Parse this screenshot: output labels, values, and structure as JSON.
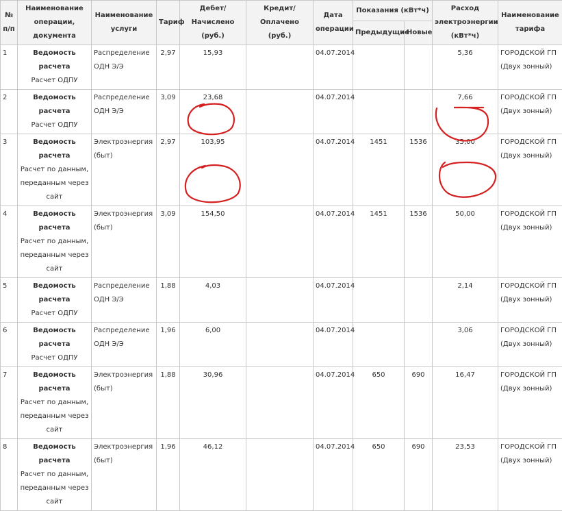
{
  "headers": {
    "num": "№ п/п",
    "operation": "Наименование операции, документа",
    "service": "Наименование услуги",
    "tariff": "Тариф",
    "debit": "Дебет/Начислено (руб.)",
    "credit": "Кредит/Оплачено (руб.)",
    "date": "Дата операции",
    "readings": "Показания (кВт*ч)",
    "readings_prev": "Предыдущие",
    "readings_new": "Новые",
    "consumption": "Расход электроэнергии (кВт*ч)",
    "tariff_name": "Наименование тарифа"
  },
  "rows": [
    {
      "num": "1",
      "doc": "Ведомость расчета",
      "doc_sub": [
        "Расчет ОДПУ"
      ],
      "service": [
        "Распределение",
        "ОДН Э/Э"
      ],
      "tariff": "2,97",
      "debit": "15,93",
      "credit": "",
      "date": "04.07.2014",
      "prev": "",
      "new": "",
      "consumption": "5,36",
      "tariff_name": [
        "ГОРОДСКОЙ ГП",
        "(Двух зонный)"
      ]
    },
    {
      "num": "2",
      "doc": "Ведомость расчета",
      "doc_sub": [
        "Расчет ОДПУ"
      ],
      "service": [
        "Распределение",
        "ОДН Э/Э"
      ],
      "tariff": "3,09",
      "debit": "23,68",
      "credit": "",
      "date": "04.07.2014",
      "prev": "",
      "new": "",
      "consumption": "7,66",
      "tariff_name": [
        "ГОРОДСКОЙ ГП",
        "(Двух зонный)"
      ]
    },
    {
      "num": "3",
      "doc": "Ведомость расчета",
      "doc_sub": [
        "Расчет по данным,",
        "переданным через",
        "сайт"
      ],
      "service": [
        "Электроэнергия",
        "(быт)"
      ],
      "tariff": "2,97",
      "debit": "103,95",
      "credit": "",
      "date": "04.07.2014",
      "prev": "1451",
      "new": "1536",
      "consumption": "35,00",
      "tariff_name": [
        "ГОРОДСКОЙ ГП",
        "(Двух зонный)"
      ]
    },
    {
      "num": "4",
      "doc": "Ведомость расчета",
      "doc_sub": [
        "Расчет по данным,",
        "переданным через",
        "сайт"
      ],
      "service": [
        "Электроэнергия",
        "(быт)"
      ],
      "tariff": "3,09",
      "debit": "154,50",
      "credit": "",
      "date": "04.07.2014",
      "prev": "1451",
      "new": "1536",
      "consumption": "50,00",
      "tariff_name": [
        "ГОРОДСКОЙ ГП",
        "(Двух зонный)"
      ]
    },
    {
      "num": "5",
      "doc": "Ведомость расчета",
      "doc_sub": [
        "Расчет ОДПУ"
      ],
      "service": [
        "Распределение",
        "ОДН Э/Э"
      ],
      "tariff": "1,88",
      "debit": "4,03",
      "credit": "",
      "date": "04.07.2014",
      "prev": "",
      "new": "",
      "consumption": "2,14",
      "tariff_name": [
        "ГОРОДСКОЙ ГП",
        "(Двух зонный)"
      ]
    },
    {
      "num": "6",
      "doc": "Ведомость расчета",
      "doc_sub": [
        "Расчет ОДПУ"
      ],
      "service": [
        "Распределение",
        "ОДН Э/Э"
      ],
      "tariff": "1,96",
      "debit": "6,00",
      "credit": "",
      "date": "04.07.2014",
      "prev": "",
      "new": "",
      "consumption": "3,06",
      "tariff_name": [
        "ГОРОДСКОЙ ГП",
        "(Двух зонный)"
      ]
    },
    {
      "num": "7",
      "doc": "Ведомость расчета",
      "doc_sub": [
        "Расчет по данным,",
        "переданным через",
        "сайт"
      ],
      "service": [
        "Электроэнергия",
        "(быт)"
      ],
      "tariff": "1,88",
      "debit": "30,96",
      "credit": "",
      "date": "04.07.2014",
      "prev": "650",
      "new": "690",
      "consumption": "16,47",
      "tariff_name": [
        "ГОРОДСКОЙ ГП",
        "(Двух зонный)"
      ]
    },
    {
      "num": "8",
      "doc": "Ведомость расчета",
      "doc_sub": [
        "Расчет по данным,",
        "переданным через",
        "сайт"
      ],
      "service": [
        "Электроэнергия",
        "(быт)"
      ],
      "tariff": "1,96",
      "debit": "46,12",
      "credit": "",
      "date": "04.07.2014",
      "prev": "650",
      "new": "690",
      "consumption": "23,53",
      "tariff_name": [
        "ГОРОДСКОЙ ГП",
        "(Двух зонный)"
      ]
    }
  ],
  "annotation_color": "#d42020"
}
